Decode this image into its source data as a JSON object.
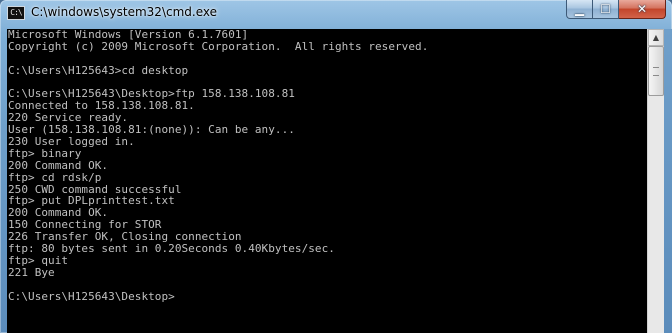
{
  "window": {
    "title": "C:\\windows\\system32\\cmd.exe",
    "icon_text": "C:\\",
    "icon": "cmd-icon"
  },
  "controls": {
    "minimize": "▁",
    "maximize": "☐",
    "close": "✕"
  },
  "scrollbar": {
    "up_arrow": "▲"
  },
  "console": {
    "lines": [
      "Microsoft Windows [Version 6.1.7601]",
      "Copyright (c) 2009 Microsoft Corporation.  All rights reserved.",
      "",
      "C:\\Users\\H125643>cd desktop",
      "",
      "C:\\Users\\H125643\\Desktop>ftp 158.138.108.81",
      "Connected to 158.138.108.81.",
      "220 Service ready.",
      "User (158.138.108.81:(none)): Can be any...",
      "230 User logged in.",
      "ftp> binary",
      "200 Command OK.",
      "ftp> cd rdsk/p",
      "250 CWD command successful",
      "ftp> put DPLprinttest.txt",
      "200 Command OK.",
      "150 Connecting for STOR",
      "226 Transfer OK, Closing connection",
      "ftp: 80 bytes sent in 0.20Seconds 0.40Kbytes/sec.",
      "ftp> quit",
      "221 Bye",
      "",
      "C:\\Users\\H125643\\Desktop>"
    ]
  }
}
